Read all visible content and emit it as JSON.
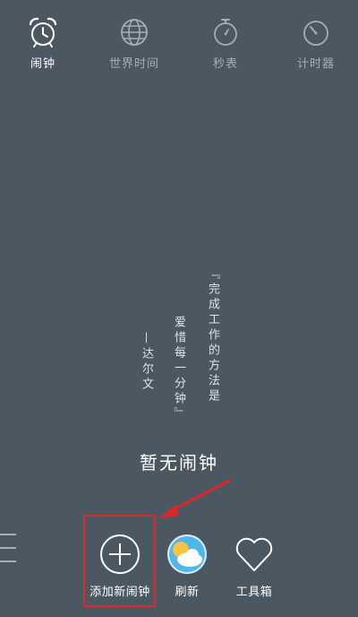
{
  "tabs": [
    {
      "label": "闹钟",
      "icon": "alarm-clock-icon",
      "active": true
    },
    {
      "label": "世界时间",
      "icon": "globe-icon",
      "active": false
    },
    {
      "label": "秒表",
      "icon": "stopwatch-icon",
      "active": false
    },
    {
      "label": "计时器",
      "icon": "timer-icon",
      "active": false
    }
  ],
  "quote": {
    "line1": "『完成工作的方法是",
    "line2": "爱惜每一分钟』",
    "author": "—达尔文"
  },
  "empty_state": "暂无闹钟",
  "actions": {
    "add_label": "添加新闹钟",
    "refresh_label": "刷新",
    "toolbox_label": "工具箱"
  },
  "colors": {
    "background": "#4b5761",
    "tab_inactive": "#a4aeb6",
    "annotation": "#e0262b",
    "refresh_sky": "#4fb8e8"
  }
}
